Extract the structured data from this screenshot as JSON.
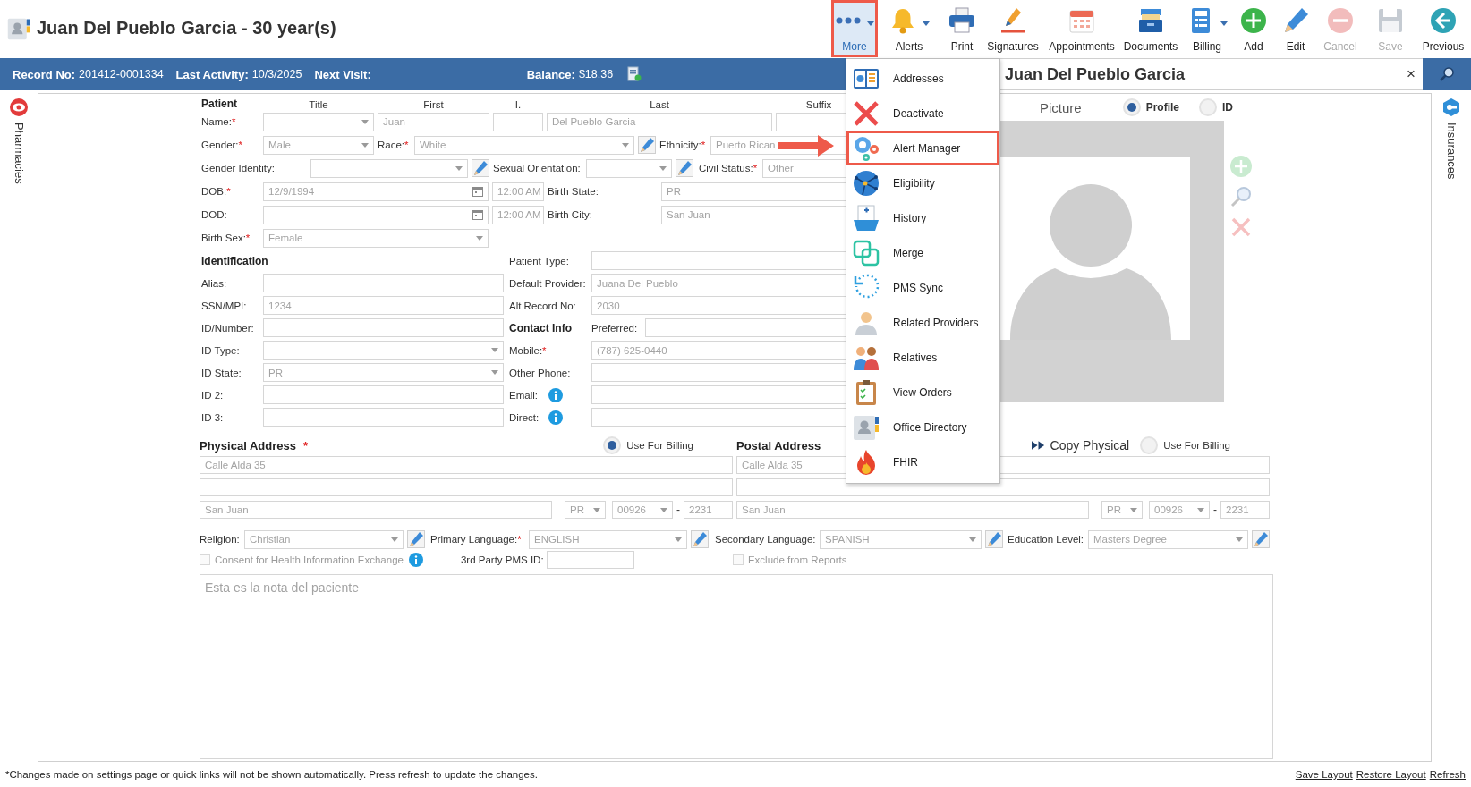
{
  "header": {
    "title": "Juan Del Pueblo Garcia - 30 year(s)"
  },
  "toolbar": [
    {
      "kind": "more",
      "label": "More",
      "caret": true,
      "selected": true,
      "highlighted": true,
      "disabled": false
    },
    {
      "kind": "alerts",
      "label": "Alerts",
      "caret": true,
      "selected": false,
      "highlighted": false,
      "disabled": false
    },
    {
      "kind": "print",
      "label": "Print",
      "caret": false,
      "selected": false,
      "highlighted": false,
      "disabled": false
    },
    {
      "kind": "signatures",
      "label": "Signatures",
      "caret": false,
      "selected": false,
      "highlighted": false,
      "disabled": false
    },
    {
      "kind": "appointments",
      "label": "Appointments",
      "caret": false,
      "selected": false,
      "highlighted": false,
      "disabled": false
    },
    {
      "kind": "documents",
      "label": "Documents",
      "caret": false,
      "selected": false,
      "highlighted": false,
      "disabled": false
    },
    {
      "kind": "billing",
      "label": "Billing",
      "caret": true,
      "selected": false,
      "highlighted": false,
      "disabled": false
    },
    {
      "kind": "add",
      "label": "Add",
      "caret": false,
      "selected": false,
      "highlighted": false,
      "disabled": false
    },
    {
      "kind": "edit",
      "label": "Edit",
      "caret": false,
      "selected": false,
      "highlighted": false,
      "disabled": false
    },
    {
      "kind": "cancel",
      "label": "Cancel",
      "caret": false,
      "selected": false,
      "highlighted": false,
      "disabled": true
    },
    {
      "kind": "save",
      "label": "Save",
      "caret": false,
      "selected": false,
      "highlighted": false,
      "disabled": true
    },
    {
      "kind": "previous",
      "label": "Previous",
      "caret": false,
      "selected": false,
      "highlighted": false,
      "disabled": false
    }
  ],
  "info_bar": [
    {
      "kind": "field",
      "label": "Record No:",
      "value": "201412-0001334"
    },
    {
      "kind": "field",
      "label": "Last Activity:",
      "value": "10/3/2025"
    },
    {
      "kind": "field",
      "label": "Next Visit:"
    },
    {
      "kind": "balance",
      "label": "Balance:",
      "value": "$18.36"
    }
  ],
  "side_panel": {
    "title": "Juan Del Pueblo Garcia",
    "close": "×"
  },
  "rails": {
    "left": "Pharmacies",
    "right": "Insurances"
  },
  "patient": {
    "rows": [
      [
        {
          "kind": "heading",
          "text": "Patient"
        },
        {
          "kind": "colhead",
          "text": "Title"
        },
        {
          "kind": "colhead",
          "text": "First"
        },
        {
          "kind": "colhead",
          "text": "I."
        },
        {
          "kind": "colhead",
          "text": "Last"
        },
        {
          "kind": "colhead",
          "text": "Suffix"
        }
      ],
      [
        {
          "kind": "label",
          "text": "Name:",
          "mark": "*"
        },
        {
          "kind": "dropdown"
        },
        {
          "kind": "text",
          "value": "Juan"
        },
        {
          "kind": "text"
        },
        {
          "kind": "text",
          "value": "Del Pueblo Garcia"
        },
        {
          "kind": "text"
        }
      ],
      [
        {
          "kind": "label",
          "text": "Gender:",
          "mark": "*"
        },
        {
          "kind": "dropdown",
          "value": "Male"
        },
        {
          "kind": "label",
          "text": "Race:",
          "mark": "*"
        },
        {
          "kind": "dropdown",
          "value": "White"
        },
        {
          "kind": "edit"
        },
        {
          "kind": "label",
          "text": "Ethnicity:",
          "mark": "*"
        },
        {
          "kind": "text",
          "value": "Puerto Rican"
        }
      ],
      [
        {
          "kind": "label",
          "text": "Gender Identity:"
        },
        {
          "kind": "dropdown"
        },
        {
          "kind": "edit"
        },
        {
          "kind": "label",
          "text": "Sexual Orientation:"
        },
        {
          "kind": "dropdown"
        },
        {
          "kind": "edit"
        },
        {
          "kind": "label",
          "text": "Civil Status:",
          "mark": "*"
        },
        {
          "kind": "text",
          "value": "Other"
        }
      ],
      [
        {
          "kind": "label",
          "text": "DOB:",
          "mark": "*"
        },
        {
          "kind": "date",
          "value": "12/9/1994"
        },
        {
          "kind": "time",
          "value": "12:00 AM"
        },
        {
          "kind": "label",
          "text": "Birth State:"
        },
        {
          "kind": "text",
          "value": "PR"
        }
      ],
      [
        {
          "kind": "label",
          "text": "DOD:"
        },
        {
          "kind": "date"
        },
        {
          "kind": "time",
          "value": "12:00 AM"
        },
        {
          "kind": "label",
          "text": "Birth City:"
        },
        {
          "kind": "text",
          "value": "San Juan"
        }
      ],
      [
        {
          "kind": "label",
          "text": "Birth Sex:",
          "mark": "*"
        },
        {
          "kind": "dropdown",
          "value": "Female"
        }
      ]
    ]
  },
  "identification": {
    "left": [
      [
        {
          "kind": "heading",
          "text": "Identification"
        }
      ],
      [
        {
          "kind": "label",
          "text": "Alias:"
        },
        {
          "kind": "text"
        }
      ],
      [
        {
          "kind": "label",
          "text": "SSN/MPI:"
        },
        {
          "kind": "text",
          "value": "1234"
        }
      ],
      [
        {
          "kind": "label",
          "text": "ID/Number:"
        },
        {
          "kind": "text"
        }
      ],
      [
        {
          "kind": "label",
          "text": "ID Type:"
        },
        {
          "kind": "dropdown"
        }
      ],
      [
        {
          "kind": "label",
          "text": "ID State:"
        },
        {
          "kind": "dropdown",
          "value": "PR"
        }
      ],
      [
        {
          "kind": "label",
          "text": "ID 2:"
        },
        {
          "kind": "text"
        }
      ],
      [
        {
          "kind": "label",
          "text": "ID 3:"
        },
        {
          "kind": "text"
        }
      ]
    ],
    "right": [
      [
        {
          "kind": "label",
          "text": "Patient Type:"
        },
        {
          "kind": "text"
        }
      ],
      [
        {
          "kind": "label",
          "text": "Default Provider:"
        },
        {
          "kind": "text",
          "value": "Juana Del Pueblo"
        }
      ],
      [
        {
          "kind": "label",
          "text": "Alt Record No:"
        },
        {
          "kind": "text",
          "value": "2030"
        }
      ],
      [
        {
          "kind": "heading",
          "text": "Contact Info"
        },
        {
          "kind": "label",
          "text": "Preferred:"
        },
        {
          "kind": "text"
        }
      ],
      [
        {
          "kind": "label",
          "text": "Mobile:",
          "mark": "*"
        },
        {
          "kind": "text",
          "value": "(787) 625-0440"
        }
      ],
      [
        {
          "kind": "label",
          "text": "Other Phone:"
        },
        {
          "kind": "text"
        }
      ],
      [
        {
          "kind": "label",
          "text": "Email:"
        },
        {
          "kind": "info"
        },
        {
          "kind": "text"
        }
      ],
      [
        {
          "kind": "label",
          "text": "Direct:"
        },
        {
          "kind": "info"
        },
        {
          "kind": "text"
        }
      ]
    ]
  },
  "picture": {
    "label": "Picture",
    "options": [
      {
        "label": "Profile",
        "selected": true
      },
      {
        "label": "ID",
        "selected": false
      }
    ]
  },
  "physical_address": {
    "title": "Physical Address",
    "mark": "*",
    "use_for_billing": {
      "label": "Use For Billing",
      "selected": true
    },
    "line1": "Calle Alda 35",
    "city": "San Juan",
    "state": "PR",
    "zip": "00926",
    "dash": "-",
    "zip_ext": "2231"
  },
  "postal_address": {
    "title": "Postal Address",
    "copy": "Copy Physical",
    "use_for_billing": {
      "label": "Use For Billing",
      "selected": false
    },
    "line1": "Calle Alda 35",
    "city": "San Juan",
    "state": "PR",
    "zip": "00926",
    "dash": "-",
    "zip_ext": "2231"
  },
  "details": [
    {
      "kind": "label",
      "text": "Religion:"
    },
    {
      "kind": "dropdown",
      "value": "Christian"
    },
    {
      "kind": "edit"
    },
    {
      "kind": "label",
      "text": "Primary Language:",
      "mark": "*"
    },
    {
      "kind": "dropdown",
      "value": "ENGLISH"
    },
    {
      "kind": "edit"
    },
    {
      "kind": "label",
      "text": "Secondary Language:"
    },
    {
      "kind": "dropdown",
      "value": "SPANISH"
    },
    {
      "kind": "edit"
    },
    {
      "kind": "label",
      "text": "Education Level:"
    },
    {
      "kind": "dropdown",
      "value": "Masters Degree"
    },
    {
      "kind": "edit"
    }
  ],
  "consent": {
    "label": "Consent for Health Information Exchange",
    "checked": false,
    "disabled": true
  },
  "pms_id": {
    "label": "3rd Party PMS ID:"
  },
  "exclude": {
    "label": "Exclude from Reports",
    "checked": false,
    "disabled": true
  },
  "notes": {
    "value": "Esta es la nota del paciente"
  },
  "menu": [
    {
      "kind": "addresses",
      "label": "Addresses",
      "highlighted": false
    },
    {
      "kind": "deactivate",
      "label": "Deactivate",
      "highlighted": false
    },
    {
      "kind": "alert_manager",
      "label": "Alert Manager",
      "highlighted": true
    },
    {
      "kind": "eligibility",
      "label": "Eligibility",
      "highlighted": false
    },
    {
      "kind": "history",
      "label": "History",
      "highlighted": false
    },
    {
      "kind": "merge",
      "label": "Merge",
      "highlighted": false
    },
    {
      "kind": "pms_sync",
      "label": "PMS Sync",
      "highlighted": false
    },
    {
      "kind": "related_providers",
      "label": "Related Providers",
      "highlighted": false
    },
    {
      "kind": "relatives",
      "label": "Relatives",
      "highlighted": false
    },
    {
      "kind": "view_orders",
      "label": "View Orders",
      "highlighted": false
    },
    {
      "kind": "office_directory",
      "label": "Office Directory",
      "highlighted": false
    },
    {
      "kind": "fhir",
      "label": "FHIR",
      "highlighted": false
    }
  ],
  "footer": {
    "note": "*Changes made on settings page or quick links will not be shown automatically. Press refresh to update the changes.",
    "links": [
      "Save Layout",
      "Restore Layout",
      "Refresh"
    ]
  }
}
